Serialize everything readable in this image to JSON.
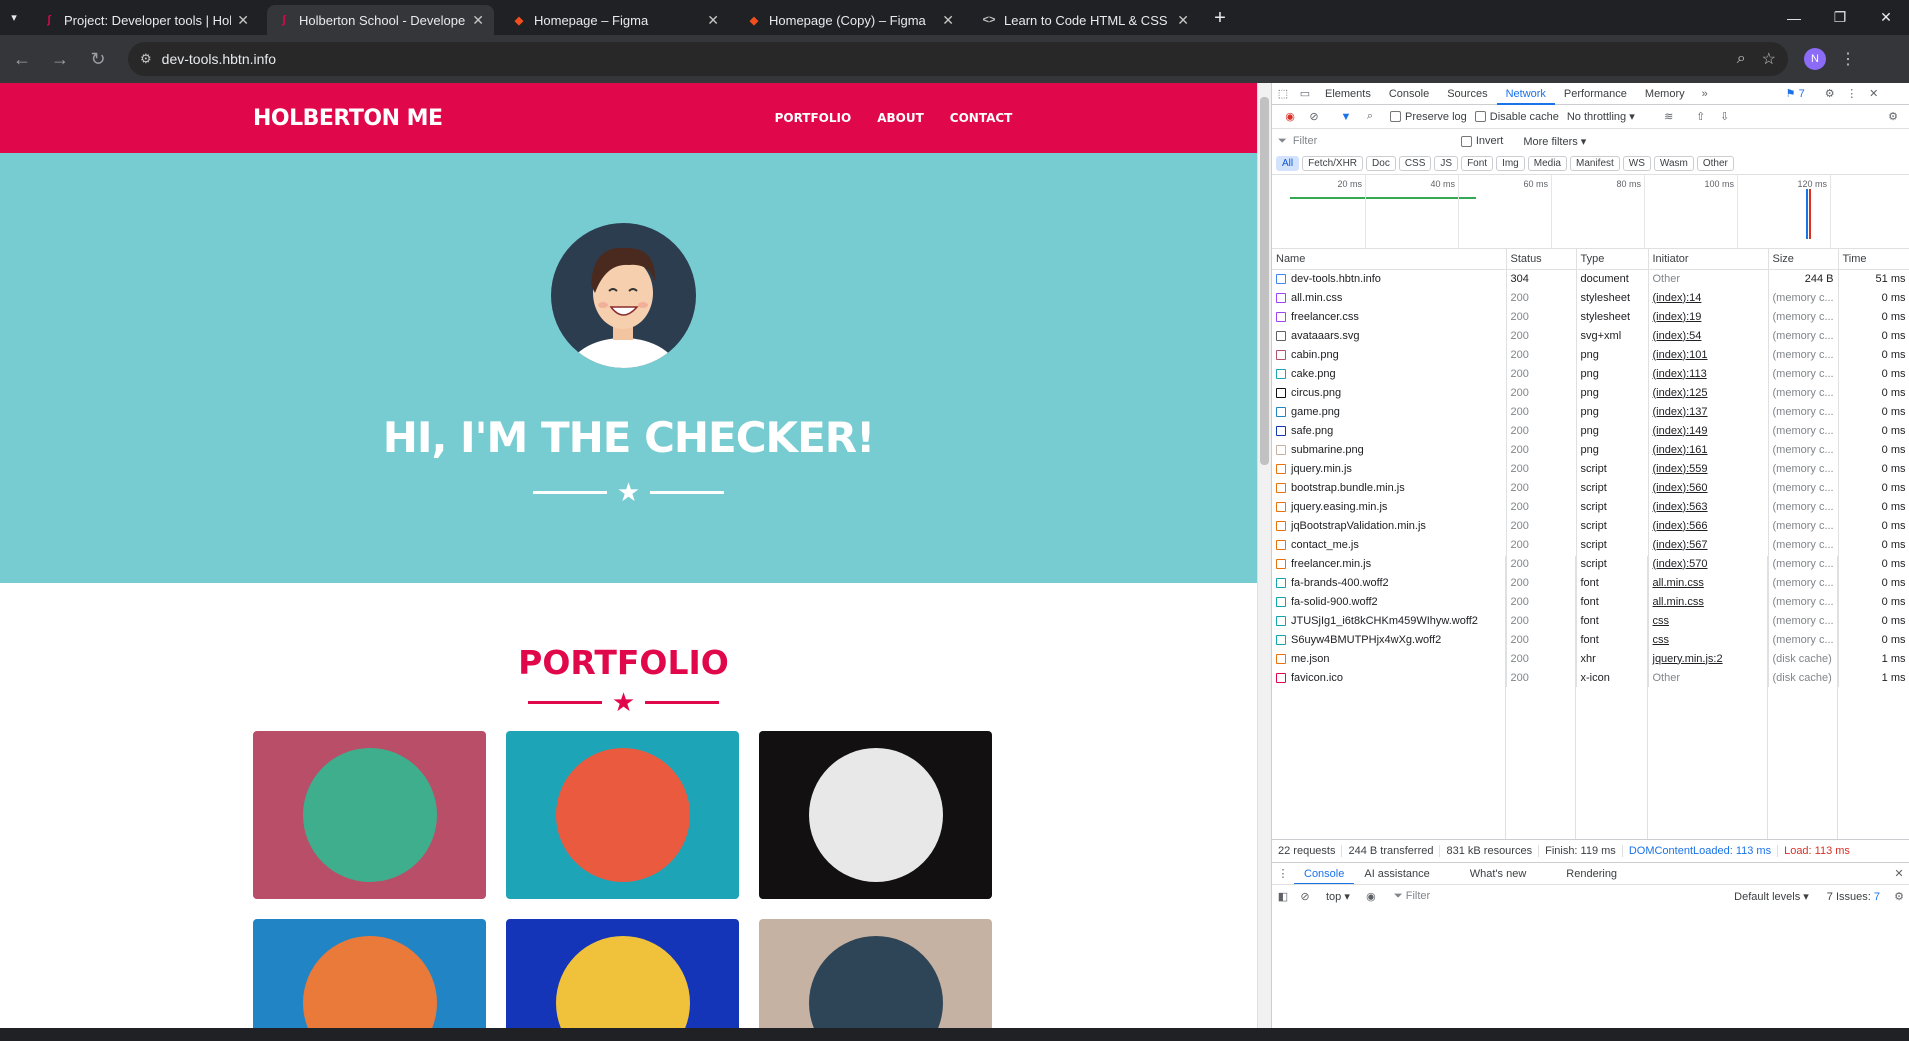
{
  "browser": {
    "tabs": [
      {
        "title": "Project: Developer tools | Holbe",
        "favicon": "holberton-icon",
        "active": false
      },
      {
        "title": "Holberton School - Developer t",
        "favicon": "holberton-icon",
        "active": true
      },
      {
        "title": "Homepage – Figma",
        "favicon": "figma-icon",
        "active": false
      },
      {
        "title": "Homepage (Copy) – Figma",
        "favicon": "figma-icon",
        "active": false
      },
      {
        "title": "Learn to Code HTML & CSS",
        "favicon": "code-icon",
        "active": false
      }
    ],
    "url": "dev-tools.hbtn.info",
    "profile_initial": "N"
  },
  "site": {
    "brand": "HOLBERTON ME",
    "nav": [
      "PORTFOLIO",
      "ABOUT",
      "CONTACT"
    ],
    "hero_title": "HI, I'M THE CHECKER!",
    "portfolio_title": "PORTFOLIO",
    "colors": {
      "primary": "#e1074b",
      "masthead": "#77ccd2"
    },
    "portfolio_items": [
      {
        "name": "cabin",
        "bg": "#b84e67",
        "circle": "#3fae8d"
      },
      {
        "name": "cake",
        "bg": "#1ea4b7",
        "circle": "#ea5a3f"
      },
      {
        "name": "circus",
        "bg": "#121010",
        "circle": "#e8e8e8"
      },
      {
        "name": "game",
        "bg": "#2185c5",
        "circle": "#ea7a3a"
      },
      {
        "name": "safe",
        "bg": "#1435b8",
        "circle": "#f0c23c"
      },
      {
        "name": "submarine",
        "bg": "#c6b2a3",
        "circle": "#2e4557"
      }
    ]
  },
  "devtools": {
    "tabs": [
      "Elements",
      "Console",
      "Sources",
      "Network",
      "Performance",
      "Memory"
    ],
    "active_tab": "Network",
    "issues_badge": "7",
    "toolbar": {
      "preserve_log": "Preserve log",
      "disable_cache": "Disable cache",
      "throttling": "No throttling"
    },
    "filter": {
      "placeholder": "Filter",
      "invert": "Invert",
      "more_filters": "More filters"
    },
    "type_filters": [
      "All",
      "Fetch/XHR",
      "Doc",
      "CSS",
      "JS",
      "Font",
      "Img",
      "Media",
      "Manifest",
      "WS",
      "Wasm",
      "Other"
    ],
    "timeline_ticks": [
      "20 ms",
      "40 ms",
      "60 ms",
      "80 ms",
      "100 ms",
      "120 ms"
    ],
    "columns": [
      "Name",
      "Status",
      "Type",
      "Initiator",
      "Size",
      "Time"
    ],
    "requests": [
      {
        "name": "dev-tools.hbtn.info",
        "status": "304",
        "type": "document",
        "initiator": "Other",
        "size": "244 B",
        "time": "51 ms",
        "icon": "#4285f4"
      },
      {
        "name": "all.min.css",
        "status": "200",
        "type": "stylesheet",
        "initiator": "(index):14",
        "size": "(memory c...",
        "time": "0 ms",
        "icon": "#a142f4"
      },
      {
        "name": "freelancer.css",
        "status": "200",
        "type": "stylesheet",
        "initiator": "(index):19",
        "size": "(memory c...",
        "time": "0 ms",
        "icon": "#a142f4"
      },
      {
        "name": "avataaars.svg",
        "status": "200",
        "type": "svg+xml",
        "initiator": "(index):54",
        "size": "(memory c...",
        "time": "0 ms",
        "icon": "#5f6368"
      },
      {
        "name": "cabin.png",
        "status": "200",
        "type": "png",
        "initiator": "(index):101",
        "size": "(memory c...",
        "time": "0 ms",
        "icon": "#b84e67"
      },
      {
        "name": "cake.png",
        "status": "200",
        "type": "png",
        "initiator": "(index):113",
        "size": "(memory c...",
        "time": "0 ms",
        "icon": "#1ea4b7"
      },
      {
        "name": "circus.png",
        "status": "200",
        "type": "png",
        "initiator": "(index):125",
        "size": "(memory c...",
        "time": "0 ms",
        "icon": "#121010"
      },
      {
        "name": "game.png",
        "status": "200",
        "type": "png",
        "initiator": "(index):137",
        "size": "(memory c...",
        "time": "0 ms",
        "icon": "#2185c5"
      },
      {
        "name": "safe.png",
        "status": "200",
        "type": "png",
        "initiator": "(index):149",
        "size": "(memory c...",
        "time": "0 ms",
        "icon": "#1435b8"
      },
      {
        "name": "submarine.png",
        "status": "200",
        "type": "png",
        "initiator": "(index):161",
        "size": "(memory c...",
        "time": "0 ms",
        "icon": "#c6b2a3"
      },
      {
        "name": "jquery.min.js",
        "status": "200",
        "type": "script",
        "initiator": "(index):559",
        "size": "(memory c...",
        "time": "0 ms",
        "icon": "#e8710a"
      },
      {
        "name": "bootstrap.bundle.min.js",
        "status": "200",
        "type": "script",
        "initiator": "(index):560",
        "size": "(memory c...",
        "time": "0 ms",
        "icon": "#e8710a"
      },
      {
        "name": "jquery.easing.min.js",
        "status": "200",
        "type": "script",
        "initiator": "(index):563",
        "size": "(memory c...",
        "time": "0 ms",
        "icon": "#e8710a"
      },
      {
        "name": "jqBootstrapValidation.min.js",
        "status": "200",
        "type": "script",
        "initiator": "(index):566",
        "size": "(memory c...",
        "time": "0 ms",
        "icon": "#e8710a"
      },
      {
        "name": "contact_me.js",
        "status": "200",
        "type": "script",
        "initiator": "(index):567",
        "size": "(memory c...",
        "time": "0 ms",
        "icon": "#e8710a"
      },
      {
        "name": "freelancer.min.js",
        "status": "200",
        "type": "script",
        "initiator": "(index):570",
        "size": "(memory c...",
        "time": "0 ms",
        "icon": "#e8710a"
      },
      {
        "name": "fa-brands-400.woff2",
        "status": "200",
        "type": "font",
        "initiator": "all.min.css",
        "size": "(memory c...",
        "time": "0 ms",
        "icon": "#12a4af"
      },
      {
        "name": "fa-solid-900.woff2",
        "status": "200",
        "type": "font",
        "initiator": "all.min.css",
        "size": "(memory c...",
        "time": "0 ms",
        "icon": "#12a4af"
      },
      {
        "name": "JTUSjIg1_i6t8kCHKm459WIhyw.woff2",
        "status": "200",
        "type": "font",
        "initiator": "css",
        "size": "(memory c...",
        "time": "0 ms",
        "icon": "#12a4af"
      },
      {
        "name": "S6uyw4BMUTPHjx4wXg.woff2",
        "status": "200",
        "type": "font",
        "initiator": "css",
        "size": "(memory c...",
        "time": "0 ms",
        "icon": "#12a4af"
      },
      {
        "name": "me.json",
        "status": "200",
        "type": "xhr",
        "initiator": "jquery.min.js:2",
        "size": "(disk cache)",
        "time": "1 ms",
        "icon": "#e8710a"
      },
      {
        "name": "favicon.ico",
        "status": "200",
        "type": "x-icon",
        "initiator": "Other",
        "size": "(disk cache)",
        "time": "1 ms",
        "icon": "#e1074b"
      }
    ],
    "status_bar": {
      "requests": "22 requests",
      "transferred": "244 B transferred",
      "resources": "831 kB resources",
      "finish": "Finish: 119 ms",
      "dcl": "DOMContentLoaded: 113 ms",
      "load": "Load: 113 ms"
    },
    "drawer": {
      "tabs": [
        "Console",
        "AI assistance",
        "What's new",
        "Rendering"
      ],
      "context": "top",
      "filter_placeholder": "Filter",
      "levels": "Default levels",
      "issues": "7 Issues:",
      "issues_count": "7"
    }
  }
}
